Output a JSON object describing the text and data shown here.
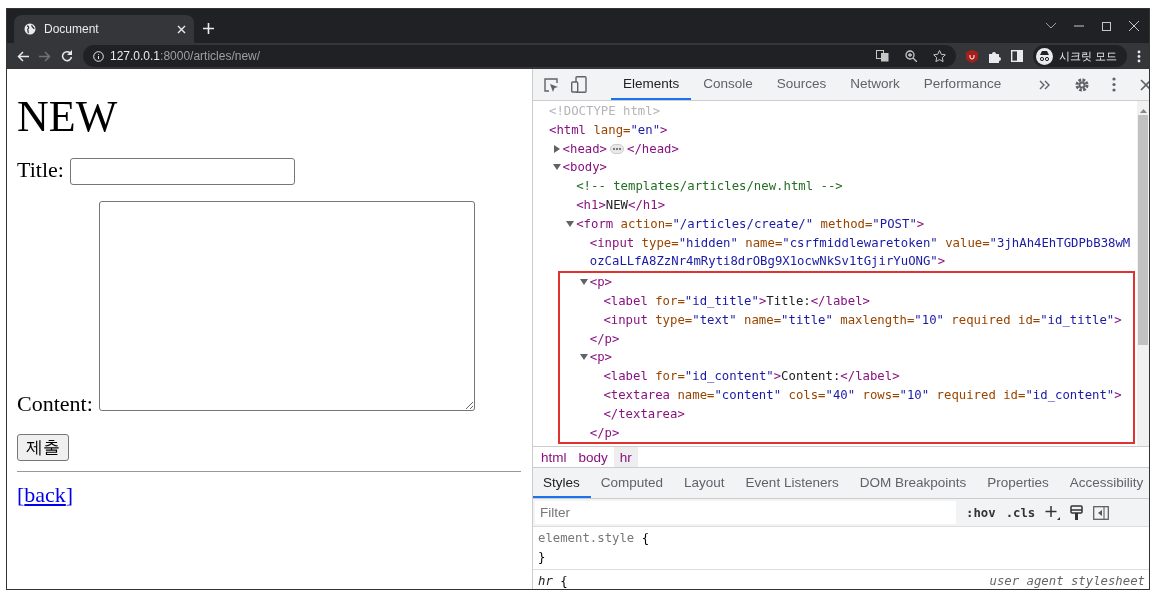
{
  "browser": {
    "tab": {
      "title": "Document"
    },
    "url": {
      "host": "127.0.0.1",
      "path": ":8000/articles/new/"
    },
    "profile": {
      "label": "시크릿 모드"
    }
  },
  "page": {
    "heading": "NEW",
    "fields": [
      {
        "kind": "text",
        "label": "Title:"
      },
      {
        "kind": "textarea",
        "label": "Content:"
      }
    ],
    "submit": "제출",
    "link": {
      "before": "[",
      "text": "back",
      "after": "]"
    }
  },
  "devtools": {
    "tabs": [
      {
        "label": "Elements",
        "selected": true
      },
      {
        "label": "Console",
        "selected": false
      },
      {
        "label": "Sources",
        "selected": false
      },
      {
        "label": "Network",
        "selected": false
      },
      {
        "label": "Performance",
        "selected": false
      }
    ],
    "dom": [
      {
        "tokens": [
          {
            "kind": "doctype",
            "text": "<!DOCTYPE html>"
          }
        ]
      },
      {
        "tokens": [
          {
            "kind": "tag",
            "text": "<html"
          },
          {
            "kind": "attr",
            "text": " lang="
          },
          {
            "kind": "value",
            "text": "\"en\""
          },
          {
            "kind": "tag",
            "text": ">"
          }
        ],
        "children": [
          {
            "expanded": false,
            "tokens": [
              {
                "kind": "tag",
                "text": "<head>"
              },
              {
                "kind": "dots"
              },
              {
                "kind": "tag",
                "text": "</head>"
              }
            ]
          },
          {
            "expanded": true,
            "tokens": [
              {
                "kind": "tag",
                "text": "<body>"
              }
            ],
            "children": [
              {
                "tokens": [
                  {
                    "kind": "comment",
                    "text": "<!-- templates/articles/new.html -->"
                  }
                ]
              },
              {
                "tokens": [
                  {
                    "kind": "tag",
                    "text": "<h1>"
                  },
                  {
                    "kind": "text",
                    "text": "NEW"
                  },
                  {
                    "kind": "tag",
                    "text": "</h1>"
                  }
                ]
              },
              {
                "expanded": true,
                "tokens": [
                  {
                    "kind": "tag",
                    "text": "<form"
                  },
                  {
                    "kind": "attr",
                    "text": " action="
                  },
                  {
                    "kind": "value",
                    "text": "\"/articles/create/\""
                  },
                  {
                    "kind": "attr",
                    "text": " method="
                  },
                  {
                    "kind": "value",
                    "text": "\"POST\""
                  },
                  {
                    "kind": "tag",
                    "text": ">"
                  }
                ],
                "children": [
                  {
                    "tokens": [
                      {
                        "kind": "tag",
                        "text": "<input"
                      },
                      {
                        "kind": "attr",
                        "text": " type="
                      },
                      {
                        "kind": "value",
                        "text": "\"hidden\""
                      },
                      {
                        "kind": "attr",
                        "text": " name="
                      },
                      {
                        "kind": "value",
                        "text": "\"csrfmiddlewaretoken\""
                      },
                      {
                        "kind": "attr",
                        "text": " value="
                      },
                      {
                        "kind": "value",
                        "text": "\"3jhAh4EhTGDPbB38wMozCaLLfA8ZzNr4mRyti8drOBg9X1ocwNkSv1tGjirYuONG\""
                      },
                      {
                        "kind": "tag",
                        "text": ">"
                      }
                    ]
                  },
                  {
                    "expanded": true,
                    "highlighted": true,
                    "tokens": [
                      {
                        "kind": "tag",
                        "text": "<p>"
                      }
                    ],
                    "children": [
                      {
                        "tokens": [
                          {
                            "kind": "tag",
                            "text": "<label"
                          },
                          {
                            "kind": "attr",
                            "text": " for="
                          },
                          {
                            "kind": "value",
                            "text": "\"id_title\""
                          },
                          {
                            "kind": "tag",
                            "text": ">"
                          },
                          {
                            "kind": "text",
                            "text": "Title:"
                          },
                          {
                            "kind": "tag",
                            "text": "</label>"
                          }
                        ]
                      },
                      {
                        "tokens": [
                          {
                            "kind": "tag",
                            "text": "<input"
                          },
                          {
                            "kind": "attr",
                            "text": " type="
                          },
                          {
                            "kind": "value",
                            "text": "\"text\""
                          },
                          {
                            "kind": "attr",
                            "text": " name="
                          },
                          {
                            "kind": "value",
                            "text": "\"title\""
                          },
                          {
                            "kind": "attr",
                            "text": " maxlength="
                          },
                          {
                            "kind": "value",
                            "text": "\"10\""
                          },
                          {
                            "kind": "attr",
                            "text": " required id="
                          },
                          {
                            "kind": "value",
                            "text": "\"id_title\""
                          },
                          {
                            "kind": "tag",
                            "text": ">"
                          }
                        ]
                      }
                    ],
                    "close": [
                      {
                        "kind": "tag",
                        "text": "</p>"
                      }
                    ]
                  },
                  {
                    "expanded": true,
                    "highlighted": true,
                    "tokens": [
                      {
                        "kind": "tag",
                        "text": "<p>"
                      }
                    ],
                    "children": [
                      {
                        "tokens": [
                          {
                            "kind": "tag",
                            "text": "<label"
                          },
                          {
                            "kind": "attr",
                            "text": " for="
                          },
                          {
                            "kind": "value",
                            "text": "\"id_content\""
                          },
                          {
                            "kind": "tag",
                            "text": ">"
                          },
                          {
                            "kind": "text",
                            "text": "Content:"
                          },
                          {
                            "kind": "tag",
                            "text": "</label>"
                          }
                        ]
                      },
                      {
                        "tokens": [
                          {
                            "kind": "tag",
                            "text": "<textarea"
                          },
                          {
                            "kind": "attr",
                            "text": " name="
                          },
                          {
                            "kind": "value",
                            "text": "\"content\""
                          },
                          {
                            "kind": "attr",
                            "text": " cols="
                          },
                          {
                            "kind": "value",
                            "text": "\"40\""
                          },
                          {
                            "kind": "attr",
                            "text": " rows="
                          },
                          {
                            "kind": "value",
                            "text": "\"10\""
                          },
                          {
                            "kind": "attr",
                            "text": " required id="
                          },
                          {
                            "kind": "value",
                            "text": "\"id_content\""
                          },
                          {
                            "kind": "tag",
                            "text": ">"
                          }
                        ]
                      },
                      {
                        "tokens": [
                          {
                            "kind": "tag",
                            "text": "</textarea>"
                          }
                        ]
                      }
                    ],
                    "close": [
                      {
                        "kind": "tag",
                        "text": "</p>"
                      }
                    ]
                  }
                ]
              }
            ]
          }
        ]
      }
    ],
    "breadcrumbs": [
      {
        "label": "html",
        "selected": false
      },
      {
        "label": "body",
        "selected": false
      },
      {
        "label": "hr",
        "selected": true
      }
    ],
    "style_tabs": [
      {
        "label": "Styles",
        "selected": true
      },
      {
        "label": "Computed",
        "selected": false
      },
      {
        "label": "Layout",
        "selected": false
      },
      {
        "label": "Event Listeners",
        "selected": false
      },
      {
        "label": "DOM Breakpoints",
        "selected": false
      },
      {
        "label": "Properties",
        "selected": false
      },
      {
        "label": "Accessibility",
        "selected": false
      }
    ],
    "filter": {
      "placeholder": "Filter"
    },
    "filter_buttons": [
      ":hov",
      ".cls"
    ],
    "rules": [
      {
        "selector": "element.style",
        "open": "{",
        "close": "}"
      },
      {
        "selector": "hr",
        "open": "{",
        "source": "user agent stylesheet"
      }
    ]
  }
}
